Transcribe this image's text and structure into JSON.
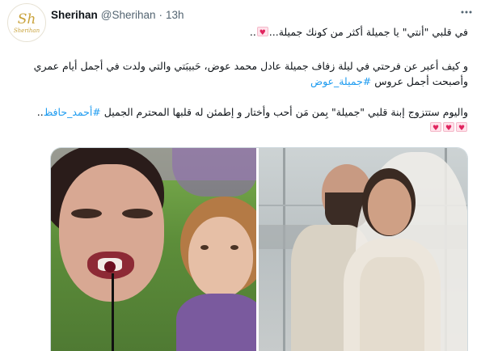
{
  "author": {
    "display_name": "Sherihan",
    "handle": "@Sherihan",
    "separator": "·",
    "time": "13h",
    "avatar_monogram": "Sh",
    "avatar_signature": "Sherihan"
  },
  "more_icon": "more-horizontal-icon",
  "tweet": {
    "p1_line1": "في قلبي \"أنتي\" يا جميلة أكثر من كونك جميلة...",
    "p1_line1_suffix": "..",
    "p2_line1": "و كيف أعبر عن فرحتي في ليلة زفاف جميلة عادل محمد عوض، حَبيبَتي والتي ولدت في أجمل أيام عمري",
    "p2_line2": "وأصبحت أجمل عروس",
    "hashtag1": "#جميلة_عوض",
    "p3_line1": "واليوم ستتزوج إبنة قلبي \"جميلة\" بِمن مَن أحب وأختار و إطمئن له قلبها المحترم الجميل",
    "hashtag2": "#أحمد_حافظ",
    "p3_line1_suffix": ".."
  },
  "emoji": {
    "name": "love-letter-icon",
    "line1_count": 1,
    "line3_count": 3
  },
  "media": {
    "left_alt": "photo-performer-with-child",
    "right_alt": "photo-wedding-couple"
  }
}
